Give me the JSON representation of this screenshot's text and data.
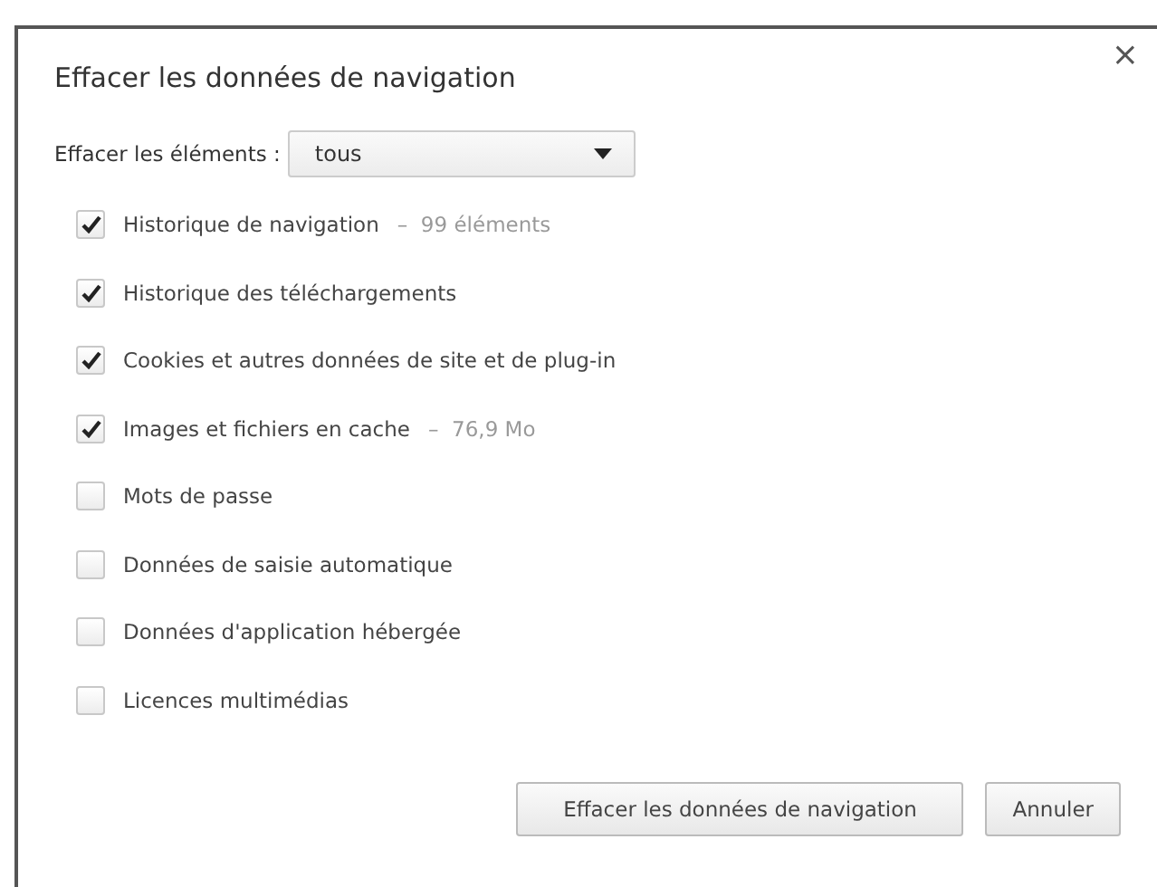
{
  "dialog": {
    "title": "Effacer les données de navigation",
    "close": "×"
  },
  "range": {
    "label": "Effacer les éléments :",
    "value": "tous"
  },
  "items": [
    {
      "label": "Historique de navigation",
      "detail": "–  99 éléments",
      "checked": true
    },
    {
      "label": "Historique des téléchargements",
      "checked": true
    },
    {
      "label": "Cookies et autres données de site et de plug-in",
      "checked": true
    },
    {
      "label": "Images et fichiers en cache",
      "detail": "–  76,9 Mo",
      "checked": true
    },
    {
      "label": "Mots de passe",
      "checked": false
    },
    {
      "label": "Données de saisie automatique",
      "checked": false
    },
    {
      "label": "Données d'application hébergée",
      "checked": false
    },
    {
      "label": "Licences multimédias",
      "checked": false
    }
  ],
  "buttons": [
    "Effacer les données de navigation",
    "Annuler"
  ]
}
